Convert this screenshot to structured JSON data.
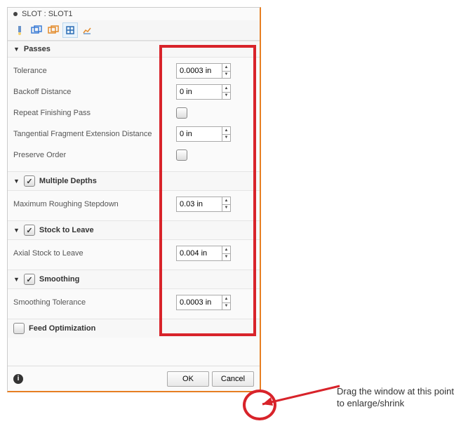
{
  "title": "SLOT : SLOT1",
  "sections": {
    "passes": {
      "title": "Passes",
      "tolerance_label": "Tolerance",
      "tolerance_value": "0.0003 in",
      "backoff_label": "Backoff Distance",
      "backoff_value": "0 in",
      "repeat_label": "Repeat Finishing Pass",
      "tangential_label": "Tangential Fragment Extension Distance",
      "tangential_value": "0 in",
      "preserve_label": "Preserve Order"
    },
    "multi_depths": {
      "title": "Multiple Depths",
      "max_rough_label": "Maximum Roughing Stepdown",
      "max_rough_value": "0.03 in"
    },
    "stock": {
      "title": "Stock to Leave",
      "axial_label": "Axial Stock to Leave",
      "axial_value": "0.004 in"
    },
    "smoothing": {
      "title": "Smoothing",
      "smooth_tol_label": "Smoothing Tolerance",
      "smooth_tol_value": "0.0003 in"
    },
    "feed_opt": {
      "title": "Feed Optimization"
    }
  },
  "footer": {
    "ok": "OK",
    "cancel": "Cancel"
  },
  "annotation": "Drag the window at this point to enlarge/shrink"
}
